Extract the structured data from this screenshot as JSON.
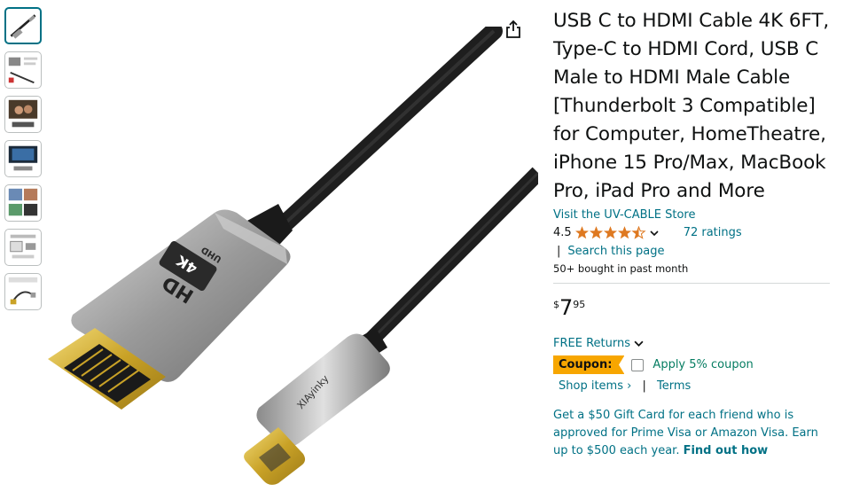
{
  "thumbnails": [
    {
      "name": "thumbnail-1",
      "selected": true
    },
    {
      "name": "thumbnail-2",
      "selected": false
    },
    {
      "name": "thumbnail-3",
      "selected": false
    },
    {
      "name": "thumbnail-4",
      "selected": false
    },
    {
      "name": "thumbnail-5",
      "selected": false
    },
    {
      "name": "thumbnail-6",
      "selected": false
    },
    {
      "name": "thumbnail-7",
      "selected": false
    }
  ],
  "main_image": {
    "connector_label_4k": "4K",
    "connector_label_uhd": "UHD",
    "connector_label_hd": "HD",
    "usbc_brand": "XIAyinky"
  },
  "share_icon": "share-icon",
  "product": {
    "title": "USB C to HDMI Cable 4K 6FT, Type-C to HDMI Cord, USB C Male to HDMI Male Cable [Thunderbolt 3 Compatible] for Computer, HomeTheatre, iPhone 15 Pro/Max, MacBook Pro, iPad Pro and More",
    "store_link": "Visit the UV-CABLE Store",
    "rating": "4.5",
    "rating_value": 4.5,
    "ratings_count": "72 ratings",
    "search_sep": "|",
    "search_link": "Search this page",
    "bought": "50+ bought in past month",
    "price_symbol": "$",
    "price_whole": "7",
    "price_fraction": "95",
    "returns": "FREE Returns",
    "coupon_label": "Coupon:",
    "coupon_apply": "Apply 5% coupon",
    "shop_items": "Shop items ›",
    "shop_sep": "|",
    "terms": "Terms",
    "gift_text": "Get a $50 Gift Card for each friend who is approved for Prime Visa or Amazon Visa. Earn up to $500 each year.",
    "find_out_how": "Find out how"
  },
  "colors": {
    "link": "#007185",
    "star": "#de7921",
    "coupon": "#f7a600",
    "green": "#067d62"
  }
}
